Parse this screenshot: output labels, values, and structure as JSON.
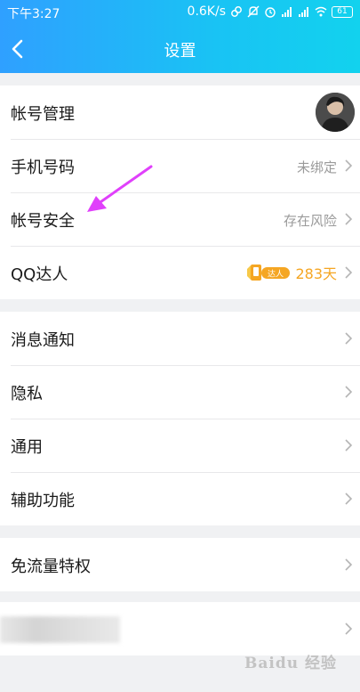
{
  "status_bar": {
    "time": "下午3:27",
    "speed": "0.6K/s",
    "battery": "61"
  },
  "nav": {
    "title": "设置"
  },
  "account_group": [
    {
      "label": "帐号管理"
    },
    {
      "label": "手机号码",
      "value": "未绑定"
    },
    {
      "label": "帐号安全",
      "value": "存在风险"
    },
    {
      "label": "QQ达人",
      "badge": "达人",
      "value": "283天"
    }
  ],
  "settings_group": [
    {
      "label": "消息通知"
    },
    {
      "label": "隐私"
    },
    {
      "label": "通用"
    },
    {
      "label": "辅助功能"
    }
  ],
  "traffic_group": [
    {
      "label": "免流量特权"
    }
  ],
  "watermark": "Baidu 经验",
  "colors": {
    "header_start": "#2fa0ff",
    "header_end": "#12d2ee",
    "accent_orange": "#f5a623",
    "annotation_arrow": "#e040fb"
  }
}
